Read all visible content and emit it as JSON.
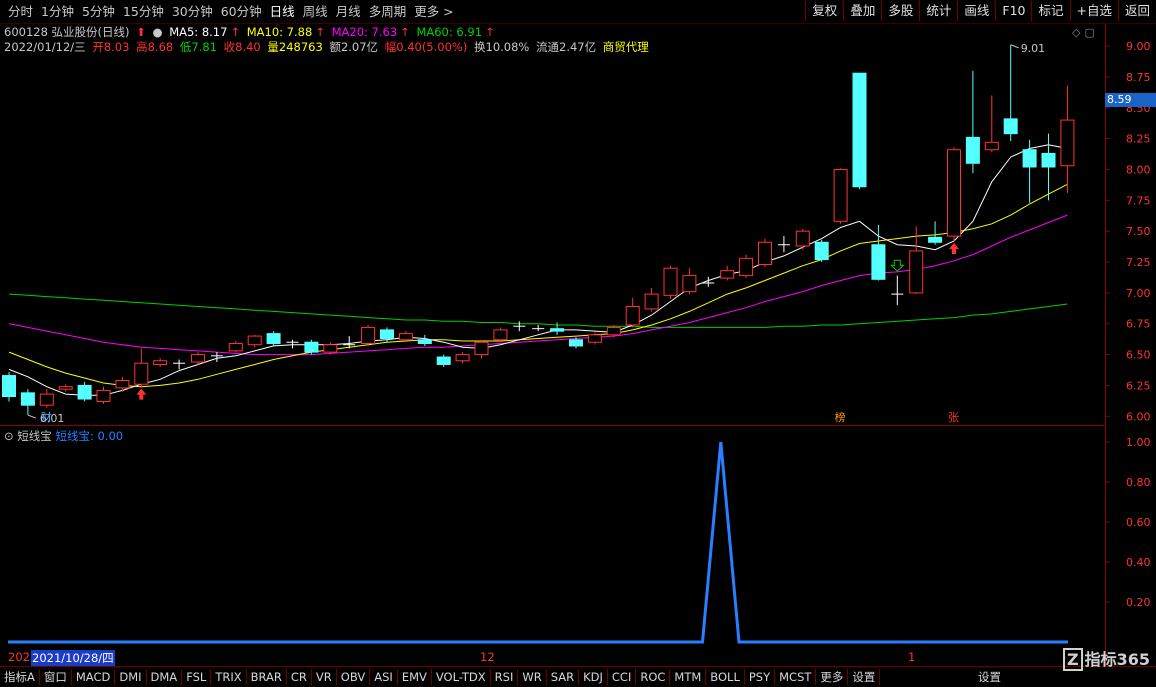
{
  "toolbar": {
    "periods": [
      "分时",
      "1分钟",
      "5分钟",
      "15分钟",
      "30分钟",
      "60分钟",
      "日线",
      "周线",
      "月线",
      "多周期",
      "更多 >"
    ],
    "active_period": "日线",
    "right_buttons": [
      "复权",
      "叠加",
      "多股",
      "统计",
      "画线",
      "F10",
      "标记",
      "+自选",
      "返回"
    ]
  },
  "stock": {
    "code_name": "600128 弘业股份(日线)",
    "ma5": "MA5: 8.17",
    "ma10": "MA10: 7.88",
    "ma20": "MA20: 7.63",
    "ma60": "MA60: 6.91",
    "date": "2022/01/12/三",
    "open": "开8.03",
    "high": "高8.68",
    "low": "低7.81",
    "close": "收8.40",
    "volume": "量248763",
    "amount": "额2.07亿",
    "change": "幅0.40(5.00%)",
    "turnover": "换10.08%",
    "float": "流通2.47亿",
    "industry": "商贸代理",
    "last_price_tag": "8.59",
    "max_label": "9.01",
    "min_label": "6.01",
    "markers": [
      "财",
      "榜",
      "张"
    ]
  },
  "indicator": {
    "name": "短线宝",
    "value_label": "短线宝: 0.00"
  },
  "dates": {
    "start_prefix": "202",
    "cursor_date": "2021/10/28/四",
    "tick_12": "12",
    "tick_1": "1"
  },
  "bottom_tabs": [
    "指标A",
    "窗口",
    "MACD",
    "DMI",
    "DMA",
    "FSL",
    "TRIX",
    "BRAR",
    "CR",
    "VR",
    "OBV",
    "ASI",
    "EMV",
    "VOL-TDX",
    "RSI",
    "WR",
    "SAR",
    "KDJ",
    "CCI",
    "ROC",
    "MTM",
    "BOLL",
    "PSY",
    "MCST",
    "更多",
    "设置"
  ],
  "bottom_extra": "设置",
  "logo_text": "指标365",
  "colors": {
    "up": "#ff3232",
    "down": "#54ffff",
    "ma5": "#ffffff",
    "ma10": "#ffff00",
    "ma20": "#ff00ff",
    "ma60": "#00d000",
    "indicator": "#2a7fff"
  },
  "chart_data": [
    {
      "type": "candlestick",
      "y_ticks": [
        9.0,
        8.75,
        8.5,
        8.25,
        8.0,
        7.75,
        7.5,
        7.25,
        7.0,
        6.75,
        6.5,
        6.25,
        6.0
      ],
      "ylim": [
        5.97,
        9.13
      ],
      "candles": [
        {
          "o": 6.33,
          "c": 6.16,
          "h": 6.36,
          "l": 6.12
        },
        {
          "o": 6.19,
          "c": 6.09,
          "h": 6.22,
          "l": 6.01
        },
        {
          "o": 6.09,
          "c": 6.18,
          "h": 6.22,
          "l": 6.07
        },
        {
          "o": 6.22,
          "c": 6.24,
          "h": 6.26,
          "l": 6.2
        },
        {
          "o": 6.25,
          "c": 6.14,
          "h": 6.28,
          "l": 6.12
        },
        {
          "o": 6.12,
          "c": 6.21,
          "h": 6.24,
          "l": 6.1
        },
        {
          "o": 6.23,
          "c": 6.29,
          "h": 6.32,
          "l": 6.2
        },
        {
          "o": 6.26,
          "c": 6.43,
          "h": 6.55,
          "l": 6.24
        },
        {
          "o": 6.42,
          "c": 6.45,
          "h": 6.47,
          "l": 6.4
        },
        {
          "o": 6.43,
          "c": 6.43,
          "h": 6.46,
          "l": 6.38
        },
        {
          "o": 6.44,
          "c": 6.5,
          "h": 6.52,
          "l": 6.42
        },
        {
          "o": 6.49,
          "c": 6.49,
          "h": 6.52,
          "l": 6.44
        },
        {
          "o": 6.53,
          "c": 6.59,
          "h": 6.61,
          "l": 6.52
        },
        {
          "o": 6.58,
          "c": 6.65,
          "h": 6.66,
          "l": 6.56
        },
        {
          "o": 6.67,
          "c": 6.59,
          "h": 6.69,
          "l": 6.57
        },
        {
          "o": 6.6,
          "c": 6.6,
          "h": 6.62,
          "l": 6.55
        },
        {
          "o": 6.6,
          "c": 6.52,
          "h": 6.62,
          "l": 6.5
        },
        {
          "o": 6.52,
          "c": 6.58,
          "h": 6.6,
          "l": 6.5
        },
        {
          "o": 6.58,
          "c": 6.58,
          "h": 6.65,
          "l": 6.55
        },
        {
          "o": 6.59,
          "c": 6.72,
          "h": 6.74,
          "l": 6.57
        },
        {
          "o": 6.7,
          "c": 6.63,
          "h": 6.72,
          "l": 6.6
        },
        {
          "o": 6.62,
          "c": 6.67,
          "h": 6.69,
          "l": 6.6
        },
        {
          "o": 6.62,
          "c": 6.59,
          "h": 6.66,
          "l": 6.57
        },
        {
          "o": 6.48,
          "c": 6.42,
          "h": 6.5,
          "l": 6.4
        },
        {
          "o": 6.45,
          "c": 6.5,
          "h": 6.52,
          "l": 6.43
        },
        {
          "o": 6.5,
          "c": 6.6,
          "h": 6.62,
          "l": 6.47
        },
        {
          "o": 6.62,
          "c": 6.7,
          "h": 6.72,
          "l": 6.6
        },
        {
          "o": 6.73,
          "c": 6.73,
          "h": 6.77,
          "l": 6.69
        },
        {
          "o": 6.71,
          "c": 6.71,
          "h": 6.74,
          "l": 6.69
        },
        {
          "o": 6.71,
          "c": 6.69,
          "h": 6.76,
          "l": 6.66
        },
        {
          "o": 6.62,
          "c": 6.57,
          "h": 6.64,
          "l": 6.55
        },
        {
          "o": 6.6,
          "c": 6.66,
          "h": 6.68,
          "l": 6.58
        },
        {
          "o": 6.66,
          "c": 6.72,
          "h": 6.74,
          "l": 6.64
        },
        {
          "o": 6.74,
          "c": 6.89,
          "h": 6.96,
          "l": 6.72
        },
        {
          "o": 6.87,
          "c": 6.99,
          "h": 7.04,
          "l": 6.85
        },
        {
          "o": 6.98,
          "c": 7.2,
          "h": 7.22,
          "l": 6.95
        },
        {
          "o": 7.01,
          "c": 7.14,
          "h": 7.2,
          "l": 6.99
        },
        {
          "o": 7.08,
          "c": 7.08,
          "h": 7.13,
          "l": 7.05
        },
        {
          "o": 7.12,
          "c": 7.18,
          "h": 7.22,
          "l": 7.1
        },
        {
          "o": 7.14,
          "c": 7.28,
          "h": 7.31,
          "l": 7.12
        },
        {
          "o": 7.23,
          "c": 7.41,
          "h": 7.44,
          "l": 7.21
        },
        {
          "o": 7.39,
          "c": 7.39,
          "h": 7.46,
          "l": 7.33
        },
        {
          "o": 7.38,
          "c": 7.5,
          "h": 7.52,
          "l": 7.35
        },
        {
          "o": 7.41,
          "c": 7.27,
          "h": 7.43,
          "l": 7.25
        },
        {
          "o": 7.58,
          "c": 8.0,
          "h": 8.01,
          "l": 7.56
        },
        {
          "o": 8.78,
          "c": 7.86,
          "h": 8.78,
          "l": 7.84
        },
        {
          "o": 7.39,
          "c": 7.11,
          "h": 7.55,
          "l": 7.1
        },
        {
          "o": 6.99,
          "c": 6.99,
          "h": 7.14,
          "l": 6.9
        },
        {
          "o": 7.0,
          "c": 7.34,
          "h": 7.54,
          "l": 6.99
        },
        {
          "o": 7.45,
          "c": 7.41,
          "h": 7.58,
          "l": 7.39
        },
        {
          "o": 7.46,
          "c": 8.16,
          "h": 8.18,
          "l": 7.42
        },
        {
          "o": 8.26,
          "c": 8.05,
          "h": 8.8,
          "l": 7.97
        },
        {
          "o": 8.16,
          "c": 8.22,
          "h": 8.6,
          "l": 8.14
        },
        {
          "o": 8.41,
          "c": 8.29,
          "h": 9.01,
          "l": 8.23
        },
        {
          "o": 8.16,
          "c": 8.02,
          "h": 8.24,
          "l": 7.73
        },
        {
          "o": 8.13,
          "c": 8.02,
          "h": 8.29,
          "l": 7.75
        },
        {
          "o": 8.03,
          "c": 8.4,
          "h": 8.68,
          "l": 7.81
        }
      ],
      "ma5": [
        6.38,
        6.32,
        6.24,
        6.18,
        6.17,
        6.17,
        6.21,
        6.26,
        6.3,
        6.37,
        6.42,
        6.47,
        6.49,
        6.53,
        6.57,
        6.58,
        6.58,
        6.58,
        6.59,
        6.61,
        6.62,
        6.64,
        6.63,
        6.6,
        6.56,
        6.55,
        6.58,
        6.62,
        6.66,
        6.7,
        6.7,
        6.69,
        6.68,
        6.74,
        6.82,
        6.93,
        7.04,
        7.1,
        7.15,
        7.18,
        7.25,
        7.3,
        7.37,
        7.44,
        7.53,
        7.58,
        7.46,
        7.39,
        7.38,
        7.35,
        7.42,
        7.58,
        7.9,
        8.1,
        8.17,
        8.2,
        8.17
      ],
      "ma10": [
        6.52,
        6.46,
        6.4,
        6.35,
        6.31,
        6.27,
        6.25,
        6.24,
        6.25,
        6.27,
        6.3,
        6.34,
        6.38,
        6.42,
        6.46,
        6.49,
        6.52,
        6.54,
        6.56,
        6.58,
        6.6,
        6.61,
        6.62,
        6.62,
        6.61,
        6.61,
        6.61,
        6.62,
        6.63,
        6.64,
        6.65,
        6.66,
        6.67,
        6.7,
        6.74,
        6.79,
        6.85,
        6.92,
        6.99,
        7.04,
        7.1,
        7.16,
        7.22,
        7.27,
        7.34,
        7.4,
        7.42,
        7.44,
        7.46,
        7.47,
        7.49,
        7.52,
        7.56,
        7.63,
        7.72,
        7.8,
        7.88
      ],
      "ma20": [
        6.75,
        6.72,
        6.69,
        6.66,
        6.63,
        6.6,
        6.58,
        6.56,
        6.55,
        6.54,
        6.53,
        6.52,
        6.51,
        6.5,
        6.5,
        6.5,
        6.5,
        6.51,
        6.52,
        6.53,
        6.54,
        6.55,
        6.56,
        6.56,
        6.57,
        6.58,
        6.59,
        6.6,
        6.61,
        6.62,
        6.63,
        6.64,
        6.65,
        6.67,
        6.7,
        6.73,
        6.76,
        6.8,
        6.84,
        6.88,
        6.93,
        6.97,
        7.01,
        7.06,
        7.1,
        7.14,
        7.16,
        7.17,
        7.19,
        7.22,
        7.26,
        7.31,
        7.38,
        7.45,
        7.51,
        7.57,
        7.63
      ],
      "ma60": [
        6.99,
        6.98,
        6.97,
        6.96,
        6.95,
        6.94,
        6.93,
        6.92,
        6.91,
        6.9,
        6.89,
        6.88,
        6.87,
        6.86,
        6.85,
        6.84,
        6.83,
        6.82,
        6.81,
        6.8,
        6.79,
        6.78,
        6.78,
        6.77,
        6.77,
        6.76,
        6.76,
        6.75,
        6.75,
        6.74,
        6.74,
        6.73,
        6.73,
        6.73,
        6.72,
        6.72,
        6.72,
        6.72,
        6.72,
        6.72,
        6.72,
        6.73,
        6.73,
        6.74,
        6.74,
        6.75,
        6.76,
        6.77,
        6.78,
        6.79,
        6.8,
        6.82,
        6.83,
        6.85,
        6.87,
        6.89,
        6.91
      ]
    },
    {
      "type": "line",
      "name": "短线宝",
      "y_ticks": [
        1.0,
        0.8,
        0.6,
        0.4,
        0.2
      ],
      "ylim": [
        -0.02,
        1.04
      ],
      "x": [
        "2021/10/28",
        "2021/12",
        "2022/1"
      ],
      "values": [
        0,
        0,
        0,
        0,
        0,
        0,
        0,
        0,
        0,
        0,
        0,
        0,
        0,
        0,
        0,
        0,
        0,
        0,
        0,
        0,
        0,
        0,
        0,
        0,
        0,
        0,
        0,
        0,
        0,
        0,
        0,
        0,
        0,
        0,
        0,
        0,
        0,
        0,
        0,
        1,
        0,
        0,
        0,
        0,
        0,
        0,
        0,
        0,
        0,
        0,
        0,
        0,
        0,
        0,
        0,
        0,
        0,
        0,
        0
      ]
    }
  ]
}
